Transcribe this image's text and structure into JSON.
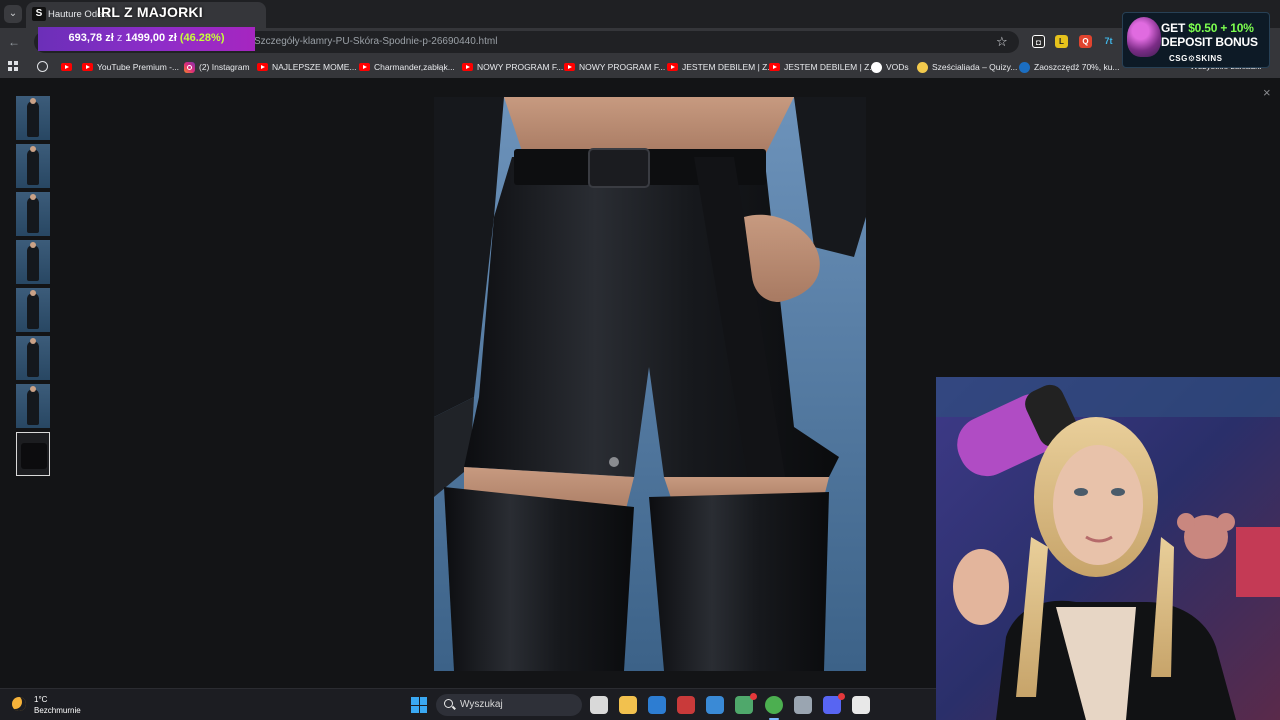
{
  "browser": {
    "tab": {
      "favicon_letter": "S",
      "title": "Hauture Odeta"
    },
    "stream_title": "IRL Z MAJORKI",
    "url": "Szczegóły-klamry-PU-Skóra-Spodnie-p-26690440.html",
    "extensions": [
      {
        "name": "twitch-extension-icon",
        "label": "",
        "color": "#ffffff"
      },
      {
        "name": "yellow-extension-icon",
        "label": "L",
        "color": "#e6c21c"
      },
      {
        "name": "red-search-extension-icon",
        "label": "Q",
        "color": "#e0442f"
      },
      {
        "name": "seven-tv-extension-icon",
        "label": "7t",
        "color": "#3fb6e8"
      }
    ],
    "bookmarks": [
      {
        "icon": "youtube",
        "label": ""
      },
      {
        "icon": "youtube",
        "label": "YouTube Premium -..."
      },
      {
        "icon": "instagram",
        "label": "(2) Instagram"
      },
      {
        "icon": "youtube",
        "label": "NAJLEPSZE MOME..."
      },
      {
        "icon": "youtube",
        "label": "Charmander,zabłąk..."
      },
      {
        "icon": "youtube",
        "label": "NOWY PROGRAM F..."
      },
      {
        "icon": "youtube",
        "label": "NOWY PROGRAM F..."
      },
      {
        "icon": "youtube",
        "label": "JESTEM DEBILEM | Z..."
      },
      {
        "icon": "youtube",
        "label": "JESTEM DEBILEM | Z..."
      },
      {
        "icon": "github",
        "label": "VODs"
      },
      {
        "icon": "quiz",
        "label": "Sześcialiada – Quizy..."
      },
      {
        "icon": "steam",
        "label": "Zaoszczędź 70%, ku..."
      }
    ],
    "bookmarks_more": "»",
    "all_bookmarks": "Wszystkie zakładki"
  },
  "donation": {
    "current": "693,78 zł",
    "of": "z",
    "goal": "1499,00 zł",
    "percent": "(46.28%)",
    "progress": 0.4628
  },
  "ad": {
    "line1_prefix": "GET ",
    "line1_amount": "$0.50 + 10%",
    "line2": "DEPOSIT BONUS",
    "brand": "CSG⚙SKINS"
  },
  "lightbox": {
    "close": "×",
    "thumbnail_count": 8,
    "active_thumbnail": 8
  },
  "taskbar": {
    "weather_temp": "1°C",
    "weather_desc": "Bezchmurnie",
    "search_placeholder": "Wyszukaj",
    "apps": [
      {
        "name": "task-view-icon",
        "color": "#d9d9d9"
      },
      {
        "name": "file-explorer-icon",
        "color": "#f2c14e"
      },
      {
        "name": "microsoft-store-icon",
        "color": "#2d7dd2"
      },
      {
        "name": "red-app-icon",
        "color": "#c93a3a"
      },
      {
        "name": "blue-app-icon",
        "color": "#3a8ad6"
      },
      {
        "name": "green-app-icon",
        "color": "#4fa86b"
      },
      {
        "name": "chrome-icon",
        "color": "#4caf50"
      },
      {
        "name": "settings-icon",
        "color": "#9aa5b1"
      },
      {
        "name": "discord-icon",
        "color": "#5865f2"
      },
      {
        "name": "obs-recording-icon",
        "color": "#e8e8e8"
      }
    ]
  }
}
